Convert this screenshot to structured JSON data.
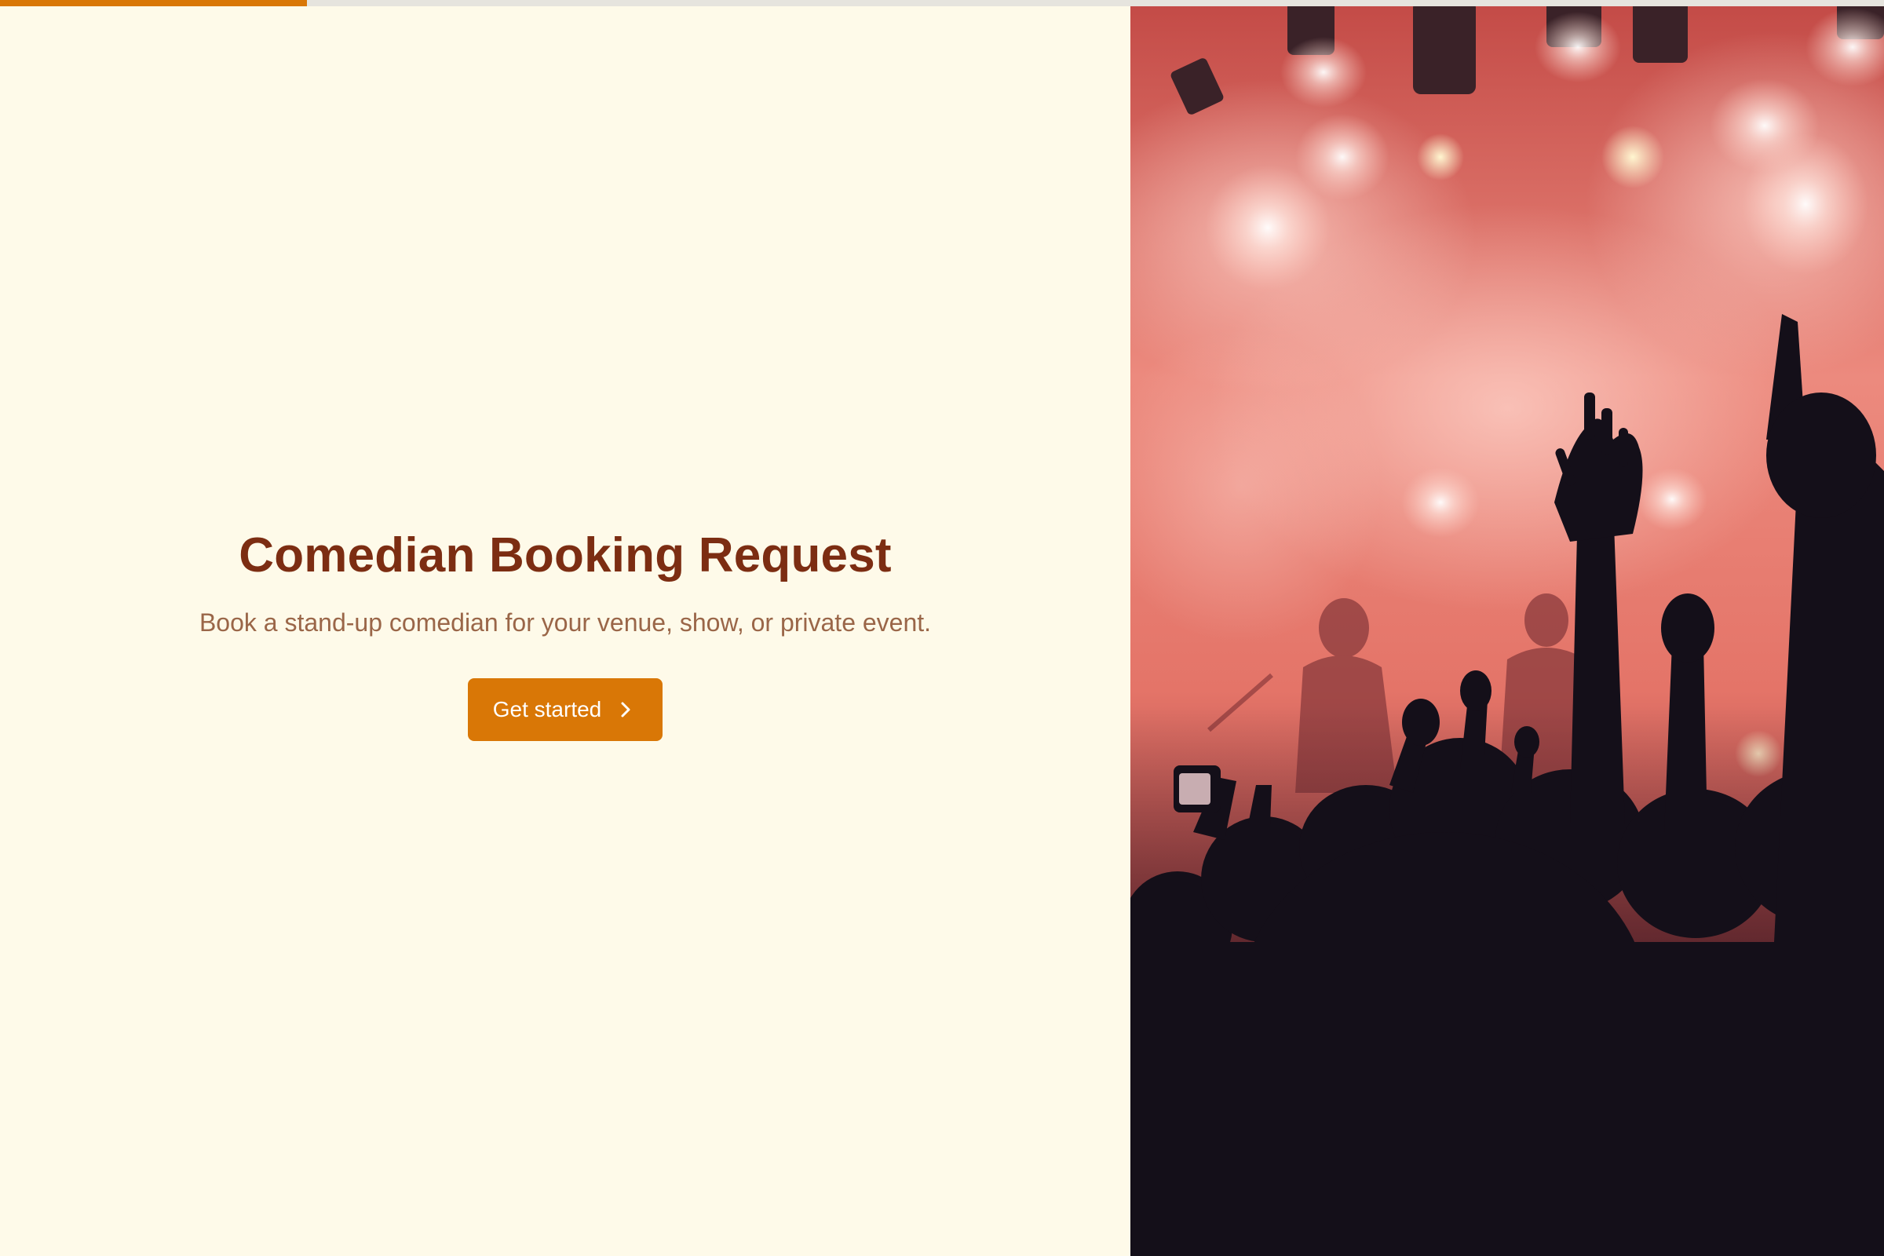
{
  "progress": {
    "value": 0.163,
    "color": "#d97706"
  },
  "intro": {
    "title": "Comedian Booking Request",
    "subtitle": "Book a stand-up comedian for your venue, show, or private event.",
    "cta_label": "Get started",
    "cta_icon": "chevron-right-icon"
  },
  "hero_image": {
    "subject": "concert-crowd-photo"
  },
  "colors": {
    "accent": "#d97706",
    "title": "#7c2d12",
    "subtitle": "#9a6648",
    "background": "#fefae9"
  }
}
